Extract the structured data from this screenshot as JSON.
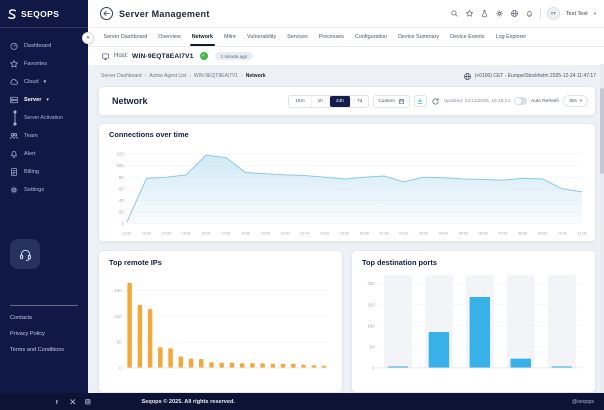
{
  "brand": {
    "name": "SEQOPS"
  },
  "header": {
    "title": "Server Management",
    "icons": [
      "search-icon",
      "star-icon",
      "labs-icon",
      "settings-icon",
      "language-icon",
      "notifications-icon"
    ],
    "user_initials": "TT",
    "user_name": "Test Test"
  },
  "tabs": {
    "active": "Network",
    "items": [
      "Server Dashboard",
      "Overview",
      "Network",
      "Mitre",
      "Vulnerability",
      "Services",
      "Processes",
      "Configuration",
      "Device Summary",
      "Device Events",
      "Log Explorer"
    ]
  },
  "host": {
    "label": "Host:",
    "name": "WIN-9EQT8EAI7V1",
    "last_seen_badge": "1 minute ago"
  },
  "breadcrumb": [
    "Server Dashboard",
    "Active Agent List",
    "WIN-9EQT8EAI7V1",
    "Network"
  ],
  "clock": {
    "text": "(+0100) CET - Europe/Stockholm 2025-12-24 11:47:17"
  },
  "network_panel": {
    "title": "Network",
    "ranges": [
      "15m",
      "1h",
      "24h",
      "7d"
    ],
    "active_range": "24h",
    "custom_label": "Custom",
    "updated_text": "Updated: 24/12/2025, 16:18:14",
    "auto_refresh_label": "Auto Refresh",
    "refresh_interval": "30s"
  },
  "sidebar": {
    "items": [
      {
        "label": "Dashboard",
        "icon": "dashboard-icon"
      },
      {
        "label": "Favorites",
        "icon": "star-icon"
      },
      {
        "label": "Cloud",
        "icon": "cloud-icon",
        "caret": true
      },
      {
        "label": "Server",
        "icon": "server-icon",
        "caret": true,
        "active": true
      },
      {
        "label": "Server Activation",
        "sub": true
      },
      {
        "label": "Team",
        "icon": "team-icon"
      },
      {
        "label": "Alert",
        "icon": "bell-icon"
      },
      {
        "label": "Billing",
        "icon": "billing-icon"
      },
      {
        "label": "Settings",
        "icon": "gear-icon"
      }
    ],
    "links": [
      "Contacts",
      "Privacy Policy",
      "Terms and Conditions"
    ]
  },
  "footer": {
    "social": [
      "facebook-icon",
      "x-icon",
      "instagram-icon"
    ],
    "copyright": "Seqops © 2025. All rights reserved.",
    "handle": "@seqops"
  },
  "colors": {
    "sidebar_bg": "#101945",
    "accent_dark": "#151d4c",
    "green": "#41b64d",
    "orange": "#f2a93b",
    "blue": "#38b1e8",
    "area_line": "#8ec9e0",
    "area_fill": "#cfe8f5"
  },
  "chart_data": [
    {
      "type": "area",
      "title": "Connections over time",
      "x": [
        "12:00",
        "13:00",
        "14:00",
        "15:00",
        "16:00",
        "17:00",
        "18:00",
        "19:00",
        "20:00",
        "21:00",
        "22:00",
        "23:00",
        "00:00",
        "01:00",
        "02:00",
        "03:00",
        "04:00",
        "05:00",
        "06:00",
        "07:00",
        "08:00",
        "09:00",
        "10:00",
        "11:00"
      ],
      "values": [
        2,
        78,
        80,
        84,
        118,
        114,
        88,
        86,
        84,
        83,
        80,
        77,
        80,
        82,
        72,
        80,
        79,
        77,
        76,
        75,
        78,
        77,
        60,
        55
      ],
      "ylim": [
        0,
        130
      ],
      "yticks": [
        0,
        20,
        40,
        60,
        80,
        100,
        120
      ],
      "grid": true,
      "legend": "none"
    },
    {
      "type": "bar",
      "title": "Top remote IPs",
      "categories": [],
      "values": [
        165,
        122,
        114,
        40,
        38,
        22,
        18,
        17,
        11,
        10,
        10,
        9,
        9,
        9,
        8,
        8,
        8,
        6,
        5,
        4
      ],
      "ylim": [
        0,
        180
      ],
      "yticks": [
        0,
        50,
        100,
        150
      ],
      "color": "#f2a93b",
      "column_bands": false
    },
    {
      "type": "bar",
      "title": "Top destination ports",
      "categories": [],
      "values": [
        3,
        85,
        168,
        22,
        3
      ],
      "ylim": [
        0,
        220
      ],
      "yticks": [
        0,
        50,
        100,
        150,
        200
      ],
      "color": "#38b1e8",
      "column_bands": true
    }
  ]
}
